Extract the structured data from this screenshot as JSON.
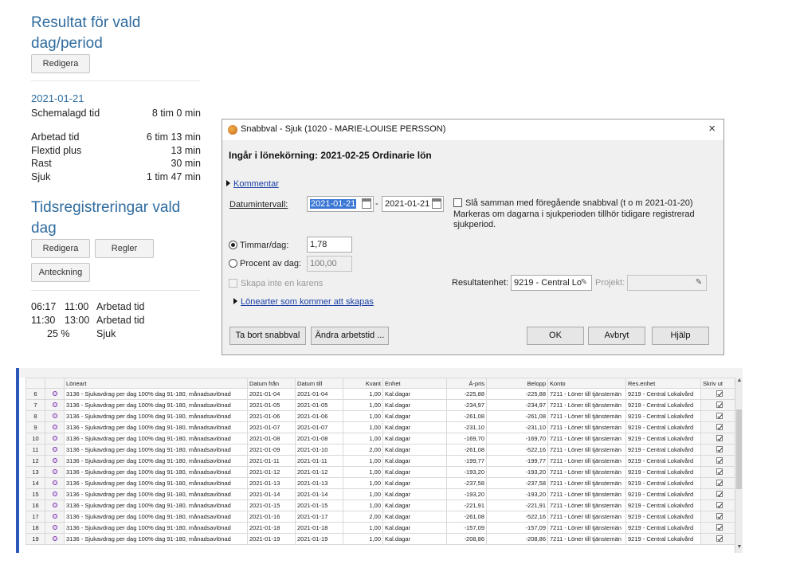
{
  "summary": {
    "title": "Resultat för vald dag/period",
    "edit_button": "Redigera",
    "date": "2021-01-21",
    "scheduled": {
      "label": "Schemalagd tid",
      "value": "8 tim 0 min"
    },
    "stats": [
      {
        "label": "Arbetad tid",
        "value": "6 tim 13 min"
      },
      {
        "label": "Flextid plus",
        "value": "13 min"
      },
      {
        "label": "Rast",
        "value": "30 min"
      },
      {
        "label": "Sjuk",
        "value": "1 tim 47 min"
      }
    ]
  },
  "registrations": {
    "title": "Tidsregistreringar vald dag",
    "edit_button": "Redigera",
    "rules_button": "Regler",
    "note_button": "Anteckning",
    "entries": [
      {
        "start": "06:17",
        "end": "11:00",
        "type": "Arbetad tid"
      },
      {
        "start": "11:30",
        "end": "13:00",
        "type": "Arbetad tid"
      },
      {
        "start": "25 %",
        "end": "",
        "type": "Sjuk"
      }
    ]
  },
  "dialog": {
    "title": "Snabbval - Sjuk (1020 - MARIE-LOUISE PERSSON)",
    "close": "×",
    "subtitle": "Ingår i lönekörning: 2021-02-25 Ordinarie lön",
    "comment_link": "Kommentar",
    "date_interval_label": "Datumintervall:",
    "date_from": "2021-01-21",
    "date_sep": "-",
    "date_to": "2021-01-21",
    "merge_label": "Slå samman med föregående snabbval (t o m 2021-01-20)",
    "merge_note": "Markeras om dagarna i sjukperioden tillhör tidigare registrerad sjukperiod.",
    "hours_label": "Timmar/dag:",
    "hours_value": "1,78",
    "percent_label": "Procent av dag:",
    "percent_value": "100,00",
    "no_karens_label": "Skapa inte en karens",
    "result_unit_label": "Resultatenhet:",
    "result_unit_value": "9219 - Central Lo",
    "project_label": "Projekt:",
    "project_value": "",
    "salary_types_link": "Lönearter som kommer att skapas",
    "btn_remove": "Ta bort snabbval",
    "btn_change": "Ändra arbetstid ...",
    "btn_ok": "OK",
    "btn_cancel": "Avbryt",
    "btn_help": "Hjälp"
  },
  "grid": {
    "columns": [
      "",
      "",
      "Löneart",
      "Datum från",
      "Datum till",
      "Kvant",
      "Enhet",
      "Á-pris",
      "Belopp",
      "Konto",
      "Res.enhet",
      "Skriv ut"
    ],
    "rows": [
      {
        "n": "6",
        "art": "3136 - Sjukavdrag per dag 100% dag 91-180, månadsavlönad",
        "from": "2021-01-04",
        "to": "2021-01-04",
        "qty": "1,00",
        "unit": "Kal.dagar",
        "price": "-225,88",
        "amount": "-225,88",
        "account": "7211 - Löner till tjänstemän",
        "res": "9219 - Central Lokalvård"
      },
      {
        "n": "7",
        "art": "3136 - Sjukavdrag per dag 100% dag 91-180, månadsavlönad",
        "from": "2021-01-05",
        "to": "2021-01-05",
        "qty": "1,00",
        "unit": "Kal.dagar",
        "price": "-234,97",
        "amount": "-234,97",
        "account": "7211 - Löner till tjänstemän",
        "res": "9219 - Central Lokalvård"
      },
      {
        "n": "8",
        "art": "3136 - Sjukavdrag per dag 100% dag 91-180, månadsavlönad",
        "from": "2021-01-06",
        "to": "2021-01-06",
        "qty": "1,00",
        "unit": "Kal.dagar",
        "price": "-261,08",
        "amount": "-261,08",
        "account": "7211 - Löner till tjänstemän",
        "res": "9219 - Central Lokalvård"
      },
      {
        "n": "9",
        "art": "3136 - Sjukavdrag per dag 100% dag 91-180, månadsavlönad",
        "from": "2021-01-07",
        "to": "2021-01-07",
        "qty": "1,00",
        "unit": "Kal.dagar",
        "price": "-231,10",
        "amount": "-231,10",
        "account": "7211 - Löner till tjänstemän",
        "res": "9219 - Central Lokalvård"
      },
      {
        "n": "10",
        "art": "3136 - Sjukavdrag per dag 100% dag 91-180, månadsavlönad",
        "from": "2021-01-08",
        "to": "2021-01-08",
        "qty": "1,00",
        "unit": "Kal.dagar",
        "price": "-169,70",
        "amount": "-169,70",
        "account": "7211 - Löner till tjänstemän",
        "res": "9219 - Central Lokalvård"
      },
      {
        "n": "11",
        "art": "3136 - Sjukavdrag per dag 100% dag 91-180, månadsavlönad",
        "from": "2021-01-09",
        "to": "2021-01-10",
        "qty": "2,00",
        "unit": "Kal.dagar",
        "price": "-261,08",
        "amount": "-522,16",
        "account": "7211 - Löner till tjänstemän",
        "res": "9219 - Central Lokalvård"
      },
      {
        "n": "12",
        "art": "3136 - Sjukavdrag per dag 100% dag 91-180, månadsavlönad",
        "from": "2021-01-11",
        "to": "2021-01-11",
        "qty": "1,00",
        "unit": "Kal.dagar",
        "price": "-199,77",
        "amount": "-199,77",
        "account": "7211 - Löner till tjänstemän",
        "res": "9219 - Central Lokalvård"
      },
      {
        "n": "13",
        "art": "3136 - Sjukavdrag per dag 100% dag 91-180, månadsavlönad",
        "from": "2021-01-12",
        "to": "2021-01-12",
        "qty": "1,00",
        "unit": "Kal.dagar",
        "price": "-193,20",
        "amount": "-193,20",
        "account": "7211 - Löner till tjänstemän",
        "res": "9219 - Central Lokalvård"
      },
      {
        "n": "14",
        "art": "3136 - Sjukavdrag per dag 100% dag 91-180, månadsavlönad",
        "from": "2021-01-13",
        "to": "2021-01-13",
        "qty": "1,00",
        "unit": "Kal.dagar",
        "price": "-237,58",
        "amount": "-237,58",
        "account": "7211 - Löner till tjänstemän",
        "res": "9219 - Central Lokalvård"
      },
      {
        "n": "15",
        "art": "3136 - Sjukavdrag per dag 100% dag 91-180, månadsavlönad",
        "from": "2021-01-14",
        "to": "2021-01-14",
        "qty": "1,00",
        "unit": "Kal.dagar",
        "price": "-193,20",
        "amount": "-193,20",
        "account": "7211 - Löner till tjänstemän",
        "res": "9219 - Central Lokalvård"
      },
      {
        "n": "16",
        "art": "3136 - Sjukavdrag per dag 100% dag 91-180, månadsavlönad",
        "from": "2021-01-15",
        "to": "2021-01-15",
        "qty": "1,00",
        "unit": "Kal.dagar",
        "price": "-221,91",
        "amount": "-221,91",
        "account": "7211 - Löner till tjänstemän",
        "res": "9219 - Central Lokalvård"
      },
      {
        "n": "17",
        "art": "3136 - Sjukavdrag per dag 100% dag 91-180, månadsavlönad",
        "from": "2021-01-16",
        "to": "2021-01-17",
        "qty": "2,00",
        "unit": "Kal.dagar",
        "price": "-261,08",
        "amount": "-522,16",
        "account": "7211 - Löner till tjänstemän",
        "res": "9219 - Central Lokalvård"
      },
      {
        "n": "18",
        "art": "3136 - Sjukavdrag per dag 100% dag 91-180, månadsavlönad",
        "from": "2021-01-18",
        "to": "2021-01-18",
        "qty": "1,00",
        "unit": "Kal.dagar",
        "price": "-157,09",
        "amount": "-157,09",
        "account": "7211 - Löner till tjänstemän",
        "res": "9219 - Central Lokalvård"
      },
      {
        "n": "19",
        "art": "3136 - Sjukavdrag per dag 100% dag 91-180, månadsavlönad",
        "from": "2021-01-19",
        "to": "2021-01-19",
        "qty": "1,00",
        "unit": "Kal.dagar",
        "price": "-208,86",
        "amount": "-208,86",
        "account": "7211 - Löner till tjänstemän",
        "res": "9219 - Central Lokalvård"
      }
    ]
  },
  "colors": {
    "heading_blue": "#2f6c9f",
    "link_blue": "#1a3fa6",
    "selection_blue": "#3a76d4",
    "grid_accent": "#2c56b8"
  }
}
